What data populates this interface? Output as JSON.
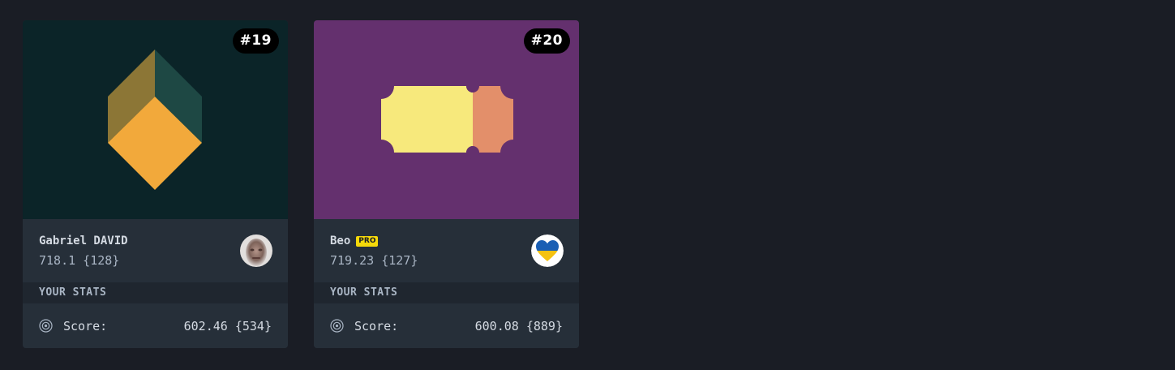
{
  "colors": {
    "page_bg": "#1a1d25",
    "card_bg": "#262f39",
    "stats_header_bg": "#1f262f",
    "pro_badge": "#f5d90a"
  },
  "cards": [
    {
      "rank": "#19",
      "art_bg": "#0b2428",
      "art_icon": "cube-icon",
      "author": "Gabriel DAVID",
      "author_score": "718.1 {128}",
      "avatar_icon": "user-photo-avatar",
      "stats_header": "YOUR STATS",
      "score_label": "Score:",
      "score_value": "602.46 {534}"
    },
    {
      "rank": "#20",
      "art_bg": "#64306e",
      "art_icon": "ticket-icon",
      "author": "Beo",
      "badge": "PRO",
      "author_score": "719.23 {127}",
      "avatar_icon": "ukraine-heart-avatar",
      "stats_header": "YOUR STATS",
      "score_label": "Score:",
      "score_value": "600.08 {889}"
    }
  ]
}
